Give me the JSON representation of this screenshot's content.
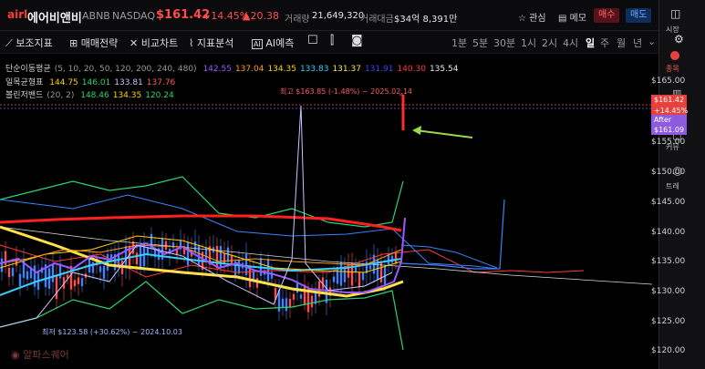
{
  "header": {
    "logo": "airl",
    "name": "에어비앤비",
    "ticker": "ABNB",
    "exchange": "NASDAQ",
    "price": "$161.42",
    "change_pct": "+14.45%",
    "change": "▲20.38",
    "volume_label": "거래량",
    "volume": "21,649,320",
    "amount_label": "거래대금",
    "amount": "$34억 8,391만",
    "favorite": "관심",
    "memo": "메모",
    "buy": "매수",
    "sell": "매도"
  },
  "toolbar": {
    "items": [
      "보조지표",
      "매매전략",
      "비교차트",
      "지표분석",
      "AI예측"
    ],
    "timeframes": [
      "1분",
      "5분",
      "30분",
      "1시",
      "2시",
      "4시",
      "일",
      "주",
      "월",
      "년"
    ],
    "active_timeframe": "일"
  },
  "sidebar": [
    "시장",
    "종목",
    "",
    "커뮤",
    "트레"
  ],
  "legend": {
    "sma_label": "단순이동평균",
    "sma_params": "(5, 10, 20, 50, 120, 200, 240, 480)",
    "sma_values": [
      "142.55",
      "137.04",
      "134.35",
      "133.83",
      "131.37",
      "131.91",
      "140.30",
      "135.54"
    ],
    "sma_colors": [
      "#9b59ff",
      "#ff9f1a",
      "#ffd400",
      "#37d0ff",
      "#ffe14a",
      "#3b45ff",
      "#ff3b3b",
      "#e8e8e8"
    ],
    "ichi_label": "일목균형표",
    "ichi_values": [
      "144.75",
      "146.01",
      "133.81",
      "137.76"
    ],
    "ichi_colors": [
      "#ffd400",
      "#2fd46a",
      "#c7c7ff",
      "#ff5a5a"
    ],
    "bb_label": "볼린저밴드",
    "bb_params": "(20, 2)",
    "bb_values": [
      "148.46",
      "134.35",
      "120.24"
    ],
    "bb_colors": [
      "#2fd46a",
      "#ffd400",
      "#2fd46a"
    ]
  },
  "axis": {
    "labels": [
      "$165.00",
      "$155.00",
      "$150.00",
      "$145.00",
      "$140.00",
      "$135.00",
      "$130.00",
      "$125.00",
      "$120.00"
    ],
    "current_price": "$161.42",
    "current_pct": "+14.45%",
    "after_label": "After",
    "after_price": "$161.09"
  },
  "annotations": {
    "high": "최고 $163.85 (-1.48%) ~ 2025.02.14",
    "low": "최저 $123.58 (+30.62%) ~ 2024.10.03",
    "watermark": "알파스퀘어"
  },
  "colors": {
    "up": "#ff4d4d",
    "down": "#3b82ff",
    "accent": "#9b59ff"
  }
}
